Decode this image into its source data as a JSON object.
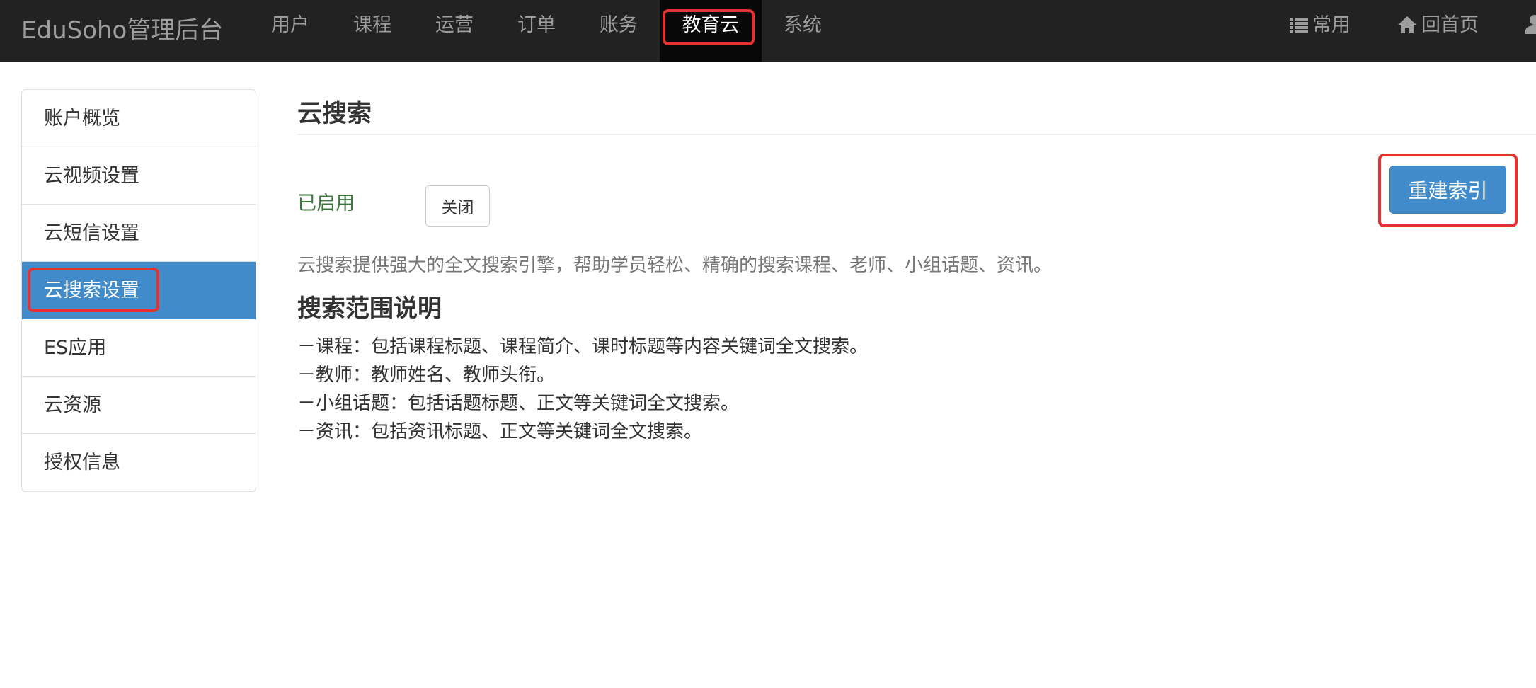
{
  "navbar": {
    "brand": "EduSoho管理后台",
    "items": [
      {
        "label": "用户"
      },
      {
        "label": "课程"
      },
      {
        "label": "运营"
      },
      {
        "label": "订单"
      },
      {
        "label": "账务"
      },
      {
        "label": "教育云",
        "active": true
      },
      {
        "label": "系统"
      }
    ],
    "right": {
      "common_icon": "list-icon",
      "common_label": "常用",
      "home_icon": "home-icon",
      "home_label": "回首页",
      "user_icon": "user-icon"
    }
  },
  "sidebar": {
    "items": [
      {
        "label": "账户概览"
      },
      {
        "label": "云视频设置"
      },
      {
        "label": "云短信设置"
      },
      {
        "label": "云搜索设置",
        "active": true
      },
      {
        "label": "ES应用"
      },
      {
        "label": "云资源"
      },
      {
        "label": "授权信息"
      }
    ]
  },
  "main": {
    "title": "云搜索",
    "status": "已启用",
    "close_button": "关闭",
    "rebuild_button": "重建索引",
    "description": "云搜索提供强大的全文搜索引擎，帮助学员轻松、精确的搜索课程、老师、小组话题、资讯。",
    "scope_title": "搜索范围说明",
    "scope_items": [
      "－课程：包括课程标题、课程简介、课时标题等内容关键词全文搜索。",
      "－教师：教师姓名、教师头衔。",
      "－小组话题：包括话题标题、正文等关键词全文搜索。",
      "－资讯：包括资讯标题、正文等关键词全文搜索。"
    ]
  },
  "colors": {
    "navbar_bg": "#222222",
    "nav_text": "#9d9d9d",
    "active_nav_bg": "#080808",
    "primary": "#428bca",
    "success_text": "#3c763d",
    "highlight_box": "#e5312f"
  }
}
